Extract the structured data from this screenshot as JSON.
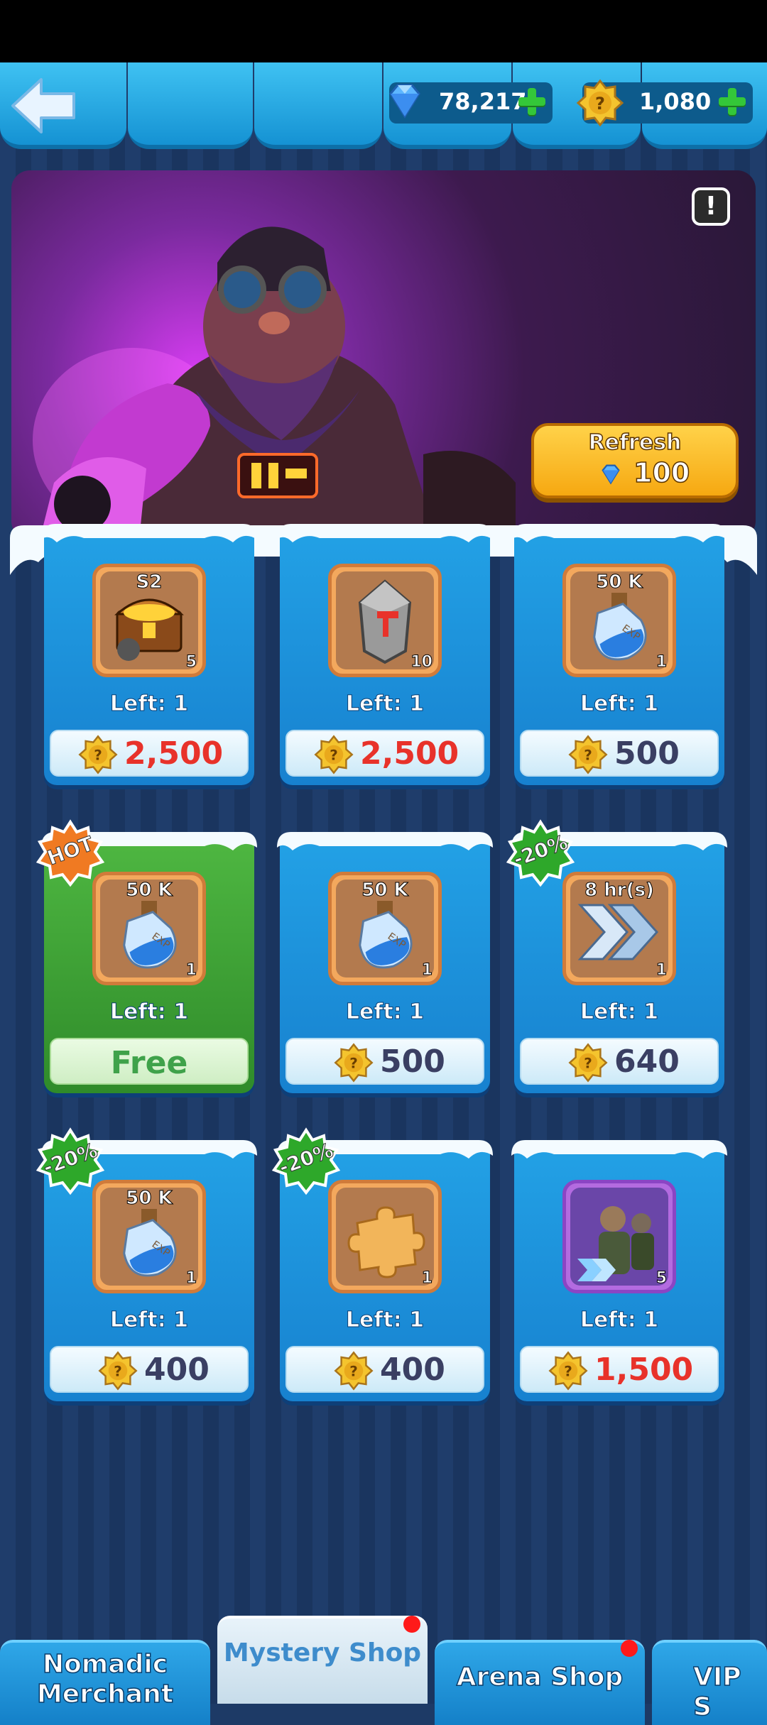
{
  "currencies": {
    "gems": {
      "value": "78,217",
      "icon": "diamond-icon"
    },
    "coins": {
      "value": "1,080",
      "icon": "gold-badge-coin-icon"
    }
  },
  "banner": {
    "refresh_label": "Refresh",
    "refresh_cost": "100",
    "info_symbol": "!"
  },
  "items": [
    {
      "name": "season-2-treasure-chest",
      "top_label": "S2",
      "qty": "5",
      "left": "Left: 1",
      "price": "2,500",
      "price_color": "#e8322a",
      "green": false,
      "badge": ""
    },
    {
      "name": "forging-stone",
      "top_label": "",
      "qty": "10",
      "left": "Left: 1",
      "price": "2,500",
      "price_color": "#e8322a",
      "green": false,
      "badge": ""
    },
    {
      "name": "exp-potion",
      "top_label": "50 K",
      "qty": "1",
      "left": "Left: 1",
      "price": "500",
      "price_color": "#3a3f63",
      "green": false,
      "badge": ""
    },
    {
      "name": "exp-potion",
      "top_label": "50 K",
      "qty": "1",
      "left": "Left: 1",
      "price": "Free",
      "price_color": "#3fa24a",
      "green": true,
      "badge": "HOT"
    },
    {
      "name": "exp-potion",
      "top_label": "50 K",
      "qty": "1",
      "left": "Left: 1",
      "price": "500",
      "price_color": "#3a3f63",
      "green": false,
      "badge": ""
    },
    {
      "name": "speed-up",
      "top_label": "8 hr(s)",
      "qty": "1",
      "left": "Left: 1",
      "price": "640",
      "price_color": "#3a3f63",
      "green": false,
      "badge": "-20%"
    },
    {
      "name": "exp-potion",
      "top_label": "50 K",
      "qty": "1",
      "left": "Left: 1",
      "price": "400",
      "price_color": "#3a3f63",
      "green": false,
      "badge": "-20%"
    },
    {
      "name": "puzzle-piece",
      "top_label": "",
      "qty": "1",
      "left": "Left: 1",
      "price": "400",
      "price_color": "#3a3f63",
      "green": false,
      "badge": "-20%"
    },
    {
      "name": "hero-troop-card",
      "top_label": "",
      "qty": "5",
      "left": "Left: 1",
      "price": "1,500",
      "price_color": "#e8322a",
      "green": false,
      "badge": ""
    }
  ],
  "tabs": [
    {
      "label": "Nomadic\nMerchant",
      "active": false,
      "dot": false
    },
    {
      "label": "Mystery Shop",
      "active": true,
      "dot": true
    },
    {
      "label": "Arena Shop",
      "active": false,
      "dot": true
    },
    {
      "label": "VIP S",
      "active": false,
      "dot": false
    }
  ],
  "colors": {
    "accent": "#1592d3",
    "price_red": "#e8322a",
    "free_green": "#3fa24a",
    "badge_orange": "#f07a22",
    "badge_green": "#2ea82a"
  }
}
